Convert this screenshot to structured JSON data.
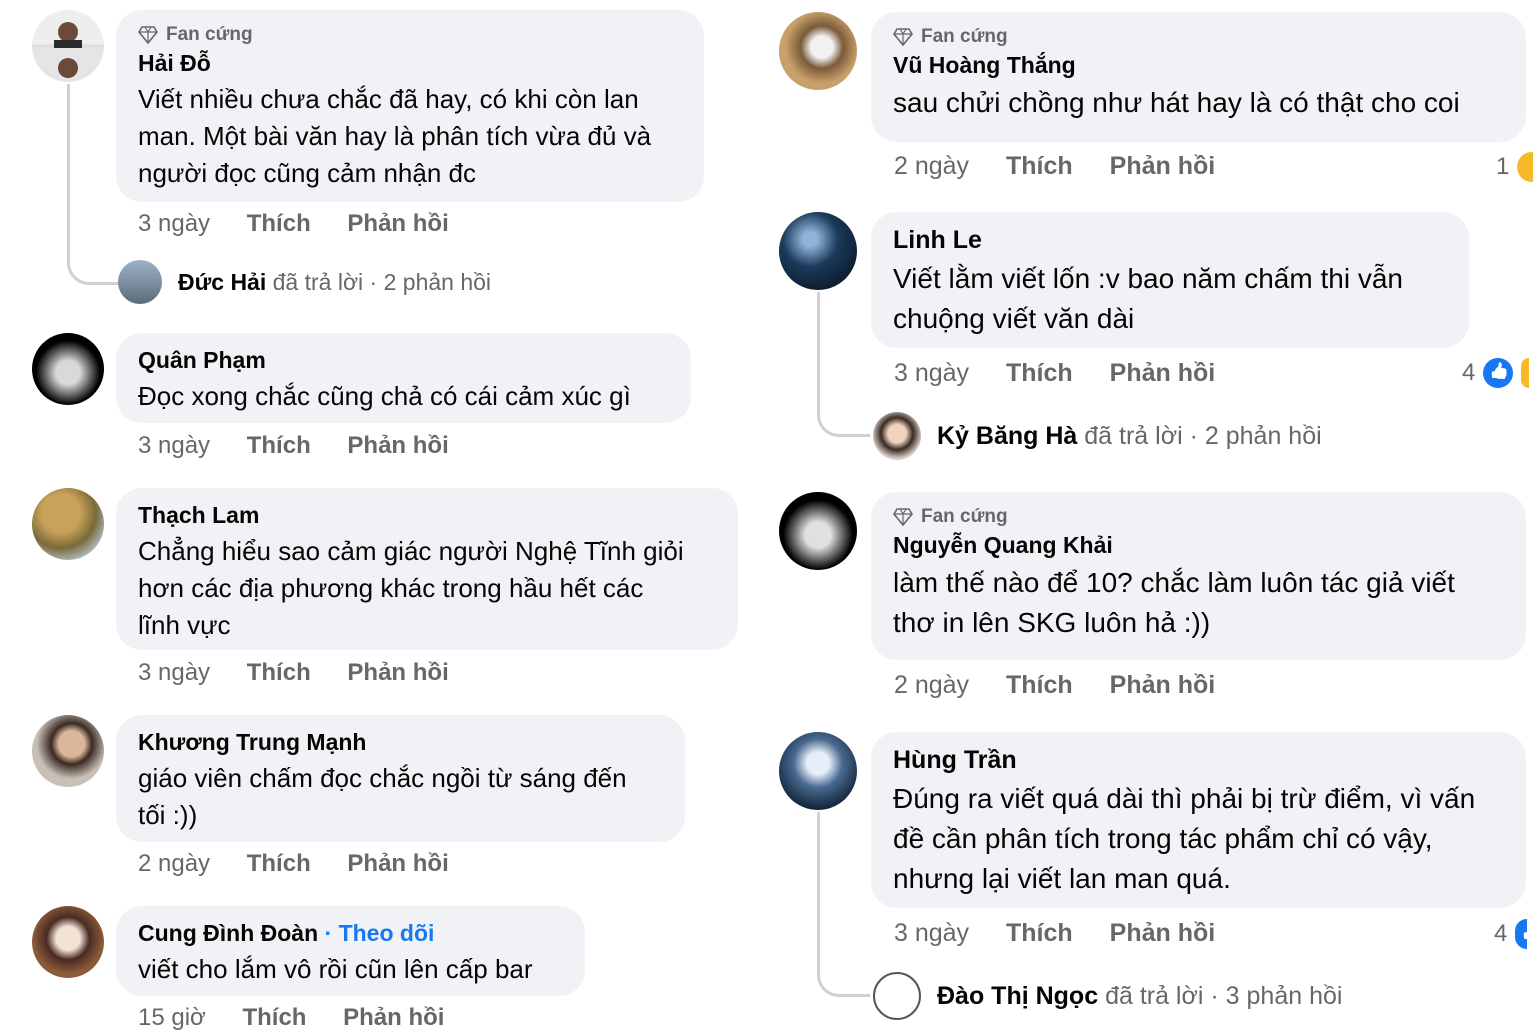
{
  "badge_label": "Fan cứng",
  "actions": {
    "like": "Thích",
    "reply": "Phản hồi"
  },
  "left": [
    {
      "badge": true,
      "author": "Hải Đỗ",
      "text_lines": [
        "Viết nhiều chưa chắc đã hay, có khi còn lan",
        "man. Một bài văn hay là phân tích vừa đủ và",
        "người đọc cũng cảm nhận đc"
      ],
      "time": "3 ngày",
      "reply": {
        "name": "Đức Hải",
        "suffix": "đã trả lời",
        "count": "· 2 phản hồi"
      }
    },
    {
      "author": "Quân Phạm",
      "text_lines": [
        "Đọc xong chắc cũng chả có cái cảm xúc gì"
      ],
      "time": "3 ngày"
    },
    {
      "author": "Thạch Lam",
      "text_lines": [
        "Chẳng hiểu sao cảm giác người Nghệ Tĩnh giỏi",
        "hơn các địa phương khác trong hầu hết các",
        "lĩnh vực"
      ],
      "time": "3 ngày"
    },
    {
      "author": "Khương Trung Mạnh",
      "text_lines": [
        "giáo viên chấm đọc chắc ngồi từ sáng đến",
        "tối :))"
      ],
      "time": "2 ngày"
    },
    {
      "author": "Cung Đình Đoàn",
      "follow": "· Theo dõi",
      "text_lines": [
        "viết cho lắm vô rồi cũn lên cấp bar"
      ],
      "time": "15 giờ"
    }
  ],
  "right": [
    {
      "badge": true,
      "author": "Vũ Hoàng Thắng",
      "text_lines": [
        "sau chửi chồng như hát hay là có thật cho coi"
      ],
      "time": "2 ngày",
      "reactions": "1"
    },
    {
      "author": "Linh Le",
      "text_lines": [
        "Viết lằm viết lốn :v bao năm chấm thi vẫn",
        "chuộng viết văn dài"
      ],
      "time": "3 ngày",
      "reactions": "4",
      "reply": {
        "name": "Kỷ Băng Hà",
        "suffix": "đã trả lời",
        "count": "· 2 phản hồi"
      }
    },
    {
      "badge": true,
      "author": "Nguyễn Quang Khải",
      "text_lines": [
        "làm thế nào để 10? chắc làm luôn tác giả viết",
        "thơ in lên SKG luôn hả :))"
      ],
      "time": "2 ngày"
    },
    {
      "author": "Hùng Trần",
      "text_lines": [
        "Đúng ra viết quá dài thì phải bị trừ điểm, vì vấn",
        "đề cần phân tích trong tác phẩm chỉ có vậy,",
        "nhưng lại viết lan man quá."
      ],
      "time": "3 ngày",
      "reactions": "4",
      "reply": {
        "name": "Đào Thị Ngọc",
        "suffix": "đã trả lời",
        "count": "· 3 phản hồi"
      }
    }
  ],
  "colors": {
    "bubble": "#f0f2f5",
    "link": "#1877f2",
    "meta": "#65676b"
  }
}
